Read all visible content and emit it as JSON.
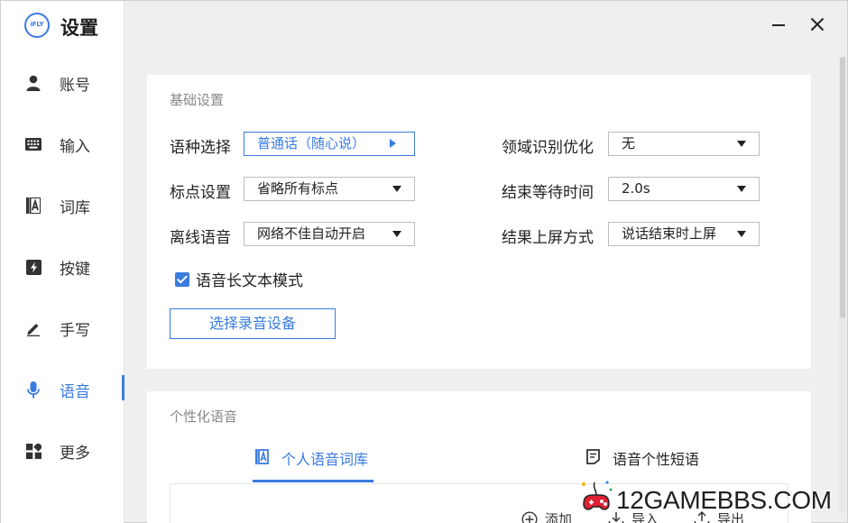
{
  "app": {
    "logo_text": "iFLY",
    "title": "设置"
  },
  "sidebar": {
    "items": [
      {
        "label": "账号",
        "icon": "person-icon"
      },
      {
        "label": "输入",
        "icon": "keyboard-icon"
      },
      {
        "label": "词库",
        "icon": "dictionary-icon"
      },
      {
        "label": "按键",
        "icon": "lightning-icon"
      },
      {
        "label": "手写",
        "icon": "pen-icon"
      },
      {
        "label": "语音",
        "icon": "microphone-icon",
        "active": true
      },
      {
        "label": "更多",
        "icon": "grid-icon"
      }
    ]
  },
  "basic": {
    "title": "基础设置",
    "language": {
      "label": "语种选择",
      "value": "普通话（随心说）"
    },
    "punctuation": {
      "label": "标点设置",
      "value": "省略所有标点"
    },
    "offline": {
      "label": "离线语音",
      "value": "网络不佳自动开启"
    },
    "domain": {
      "label": "领域识别优化",
      "value": "无"
    },
    "wait_time": {
      "label": "结束等待时间",
      "value": "2.0s"
    },
    "commit_mode": {
      "label": "结果上屏方式",
      "value": "说话结束时上屏"
    },
    "long_text": {
      "label": "语音长文本模式",
      "checked": true
    },
    "device_button": "选择录音设备"
  },
  "personal": {
    "title": "个性化语音",
    "tabs": [
      {
        "label": "个人语音词库",
        "icon": "dictionary-icon",
        "active": true
      },
      {
        "label": "语音个性短语",
        "icon": "note-icon",
        "active": false
      }
    ],
    "actions": {
      "add": "添加",
      "import": "导入",
      "export": "导出"
    }
  },
  "watermark": {
    "text": "12GAMEBBS.COM"
  },
  "colors": {
    "accent": "#3a7be0",
    "background": "#efefef",
    "card": "#ffffff"
  }
}
